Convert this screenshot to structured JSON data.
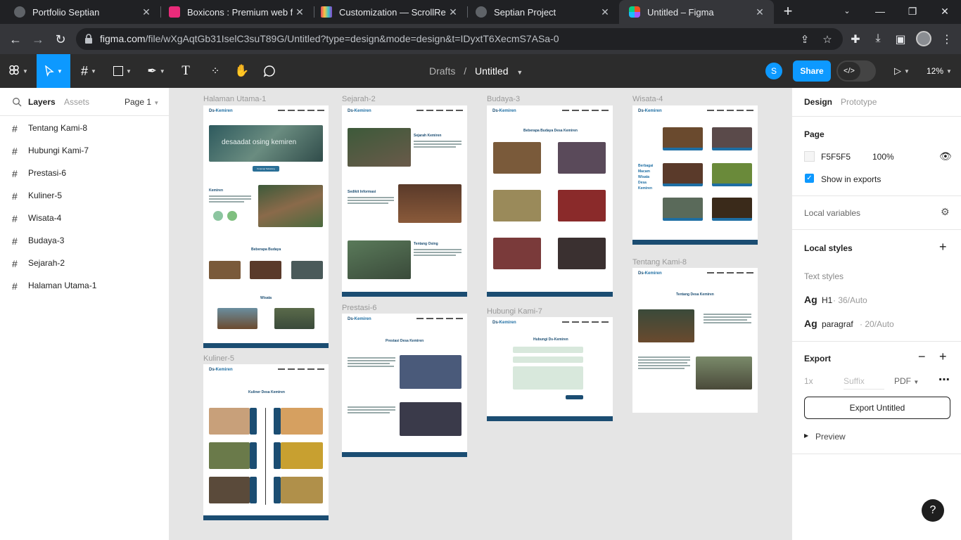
{
  "browser": {
    "tabs": [
      {
        "title": "Portfolio Septian",
        "active": false
      },
      {
        "title": "Boxicons : Premium web friendly icons",
        "active": false
      },
      {
        "title": "Customization — ScrollReveal",
        "active": false
      },
      {
        "title": "Septian Project",
        "active": false
      },
      {
        "title": "Untitled – Figma",
        "active": true
      }
    ],
    "url_host": "figma.com",
    "url_path": "/file/wXgAqtGb31IselC3suT89G/Untitled?type=design&mode=design&t=IDyxtT6XecmS7ASa-0"
  },
  "figma": {
    "breadcrumb_parent": "Drafts",
    "breadcrumb_sep": "/",
    "file_name": "Untitled",
    "user_initial": "S",
    "share_label": "Share",
    "zoom": "12%",
    "left_tabs": {
      "layers": "Layers",
      "assets": "Assets",
      "page": "Page 1"
    },
    "layers": [
      "Tentang Kami-8",
      "Hubungi Kami-7",
      "Prestasi-6",
      "Kuliner-5",
      "Wisata-4",
      "Budaya-3",
      "Sejarah-2",
      "Halaman Utama-1"
    ],
    "right_tabs": {
      "design": "Design",
      "prototype": "Prototype"
    },
    "page_section": {
      "title": "Page",
      "color_hex": "F5F5F5",
      "opacity": "100%",
      "show_in_exports": "Show in exports"
    },
    "local_variables": "Local variables",
    "local_styles": {
      "title": "Local styles",
      "text_styles": "Text styles",
      "styles": [
        {
          "ag": "Ag",
          "name": "H1",
          "meta": "· 36/Auto"
        },
        {
          "ag": "Ag",
          "name": "paragraf",
          "meta": "· 20/Auto"
        }
      ]
    },
    "export": {
      "title": "Export",
      "scale": "1x",
      "suffix": "Suffix",
      "format": "PDF",
      "button": "Export Untitled",
      "preview": "Preview"
    },
    "help": "?"
  },
  "canvas_frames": [
    {
      "label": "Halaman Utama-1"
    },
    {
      "label": "Sejarah-2"
    },
    {
      "label": "Budaya-3"
    },
    {
      "label": "Wisata-4"
    },
    {
      "label": "Kuliner-5"
    },
    {
      "label": "Prestasi-6"
    },
    {
      "label": "Hubungi Kami-7"
    },
    {
      "label": "Tentang Kami-8"
    }
  ],
  "frame_text": {
    "logo_a": "Ds-",
    "logo_b": "Kemiren",
    "hero_text": "desaadat osing kemiren",
    "hero_button": "Kunjungi Sekarang",
    "home_kemiren": "Kemiren",
    "home_budaya": "Beberapa Budaya",
    "home_wisata": "Wisata",
    "sejarah_1": "Sejarah Kemiren",
    "sejarah_2": "Sedikit Informasi",
    "sejarah_3": "Tentang Osing",
    "budaya_title": "Beberapa Budaya Desa Kemiren",
    "wisata_side": "Berbagai Macam Wisata Desa Kemiren",
    "kuliner_title": "Kuliner Desa Kemiren",
    "prestasi_title": "Prestasi Desa Kemiren",
    "hubungi_title": "Hubungi Ds-Kemiren",
    "tentang_title": "Tentang Desa Kemiren"
  },
  "colors": {
    "figma_blue": "#0d99ff",
    "brand_dark": "#1b4d72",
    "frame_accent": "#1e6ea3"
  }
}
